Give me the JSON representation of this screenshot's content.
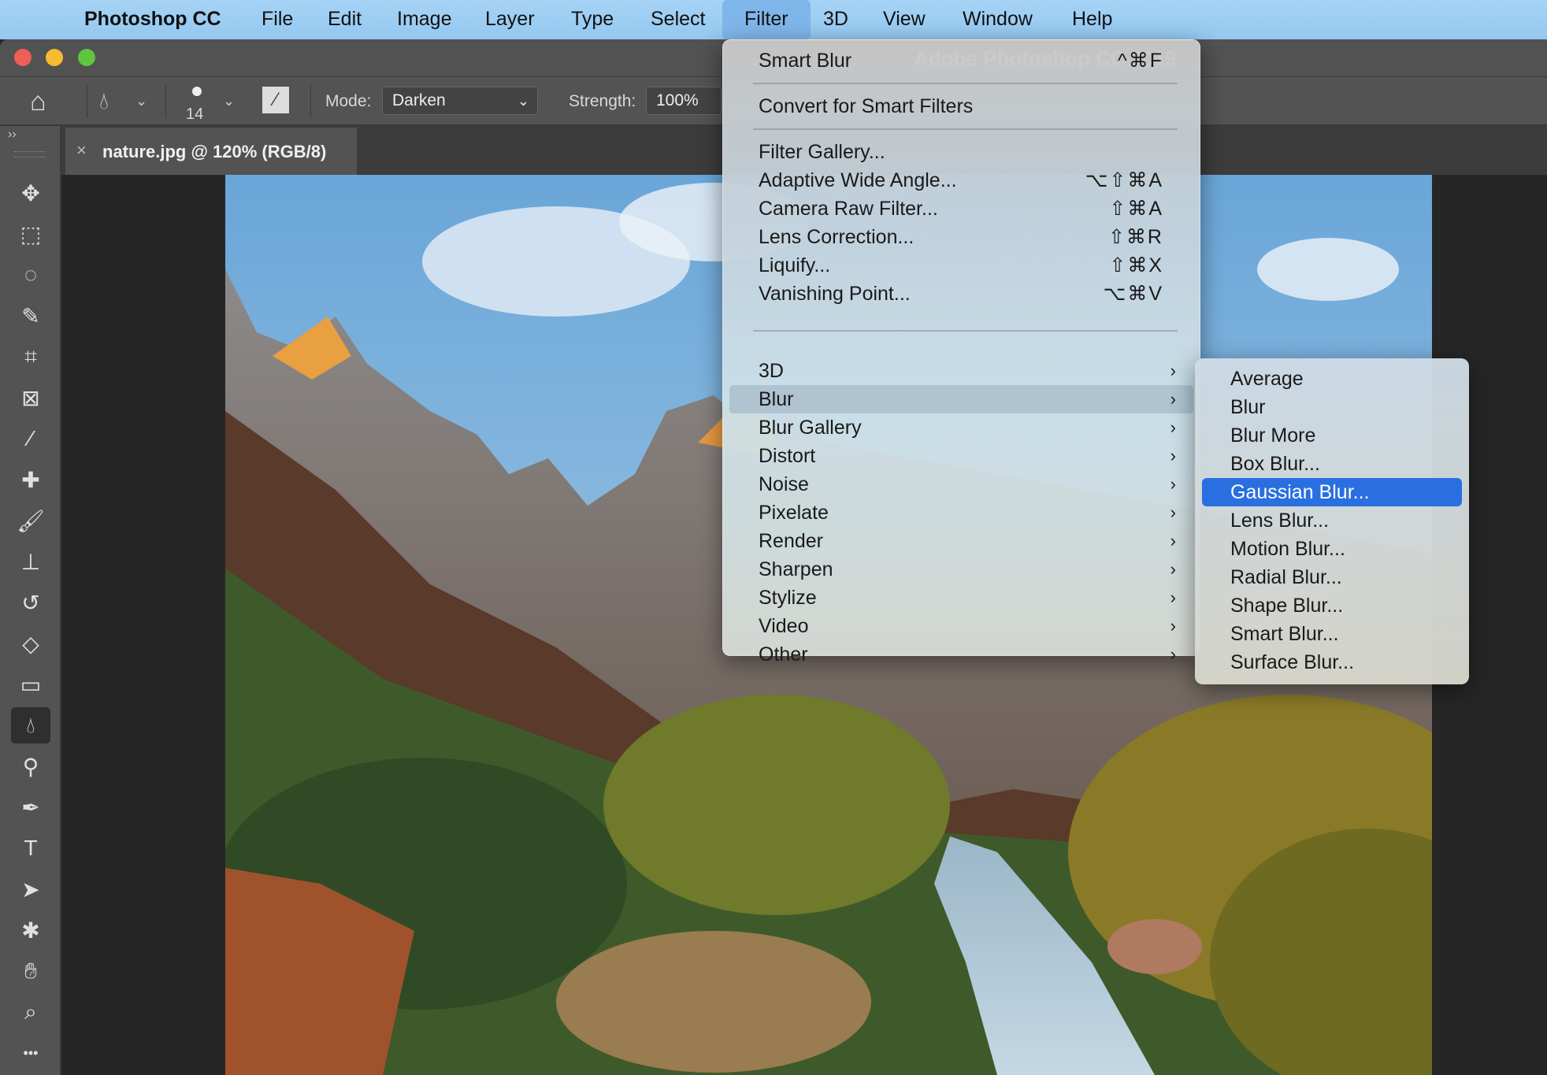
{
  "menubar": {
    "app": "Photoshop CC",
    "items": [
      "File",
      "Edit",
      "Image",
      "Layer",
      "Type",
      "Select",
      "Filter",
      "3D",
      "View",
      "Window",
      "Help"
    ],
    "active": "Filter"
  },
  "window": {
    "title": "Adobe Photoshop CC 2019"
  },
  "options": {
    "brush_size": "14",
    "mode_label": "Mode:",
    "mode_value": "Darken",
    "strength_label": "Strength:",
    "strength_value": "100%"
  },
  "document_tab": {
    "label": "nature.jpg @ 120% (RGB/8)",
    "close": "×"
  },
  "toolbar": {
    "collapse": "››",
    "tools": [
      "move",
      "rectangular-marquee",
      "lasso",
      "quick-selection",
      "crop",
      "frame",
      "eyedropper",
      "healing-brush",
      "brush",
      "clone-stamp",
      "history-brush",
      "eraser",
      "gradient",
      "blur",
      "dodge",
      "pen",
      "type",
      "path-selection",
      "custom-shape",
      "hand",
      "zoom",
      "more"
    ],
    "active": "blur"
  },
  "filter_menu": {
    "top": [
      {
        "label": "Smart Blur",
        "shortcut": "^⌘F"
      },
      {
        "label": "Convert for Smart Filters",
        "shortcut": ""
      }
    ],
    "filters": [
      {
        "label": "Filter Gallery...",
        "shortcut": ""
      },
      {
        "label": "Adaptive Wide Angle...",
        "shortcut": "⌥⇧⌘A"
      },
      {
        "label": "Camera Raw Filter...",
        "shortcut": "⇧⌘A"
      },
      {
        "label": "Lens Correction...",
        "shortcut": "⇧⌘R"
      },
      {
        "label": "Liquify...",
        "shortcut": "⇧⌘X"
      },
      {
        "label": "Vanishing Point...",
        "shortcut": "⌥⌘V"
      }
    ],
    "submenus": [
      "3D",
      "Blur",
      "Blur Gallery",
      "Distort",
      "Noise",
      "Pixelate",
      "Render",
      "Sharpen",
      "Stylize",
      "Video",
      "Other"
    ],
    "highlighted": "Blur"
  },
  "blur_submenu": {
    "items": [
      "Average",
      "Blur",
      "Blur More",
      "Box Blur...",
      "Gaussian Blur...",
      "Lens Blur...",
      "Motion Blur...",
      "Radial Blur...",
      "Shape Blur...",
      "Smart Blur...",
      "Surface Blur..."
    ],
    "highlighted": "Gaussian Blur..."
  },
  "colors": {
    "menubar": "#9fcff4",
    "highlight": "#2a6fe0",
    "panel": "#535353"
  }
}
